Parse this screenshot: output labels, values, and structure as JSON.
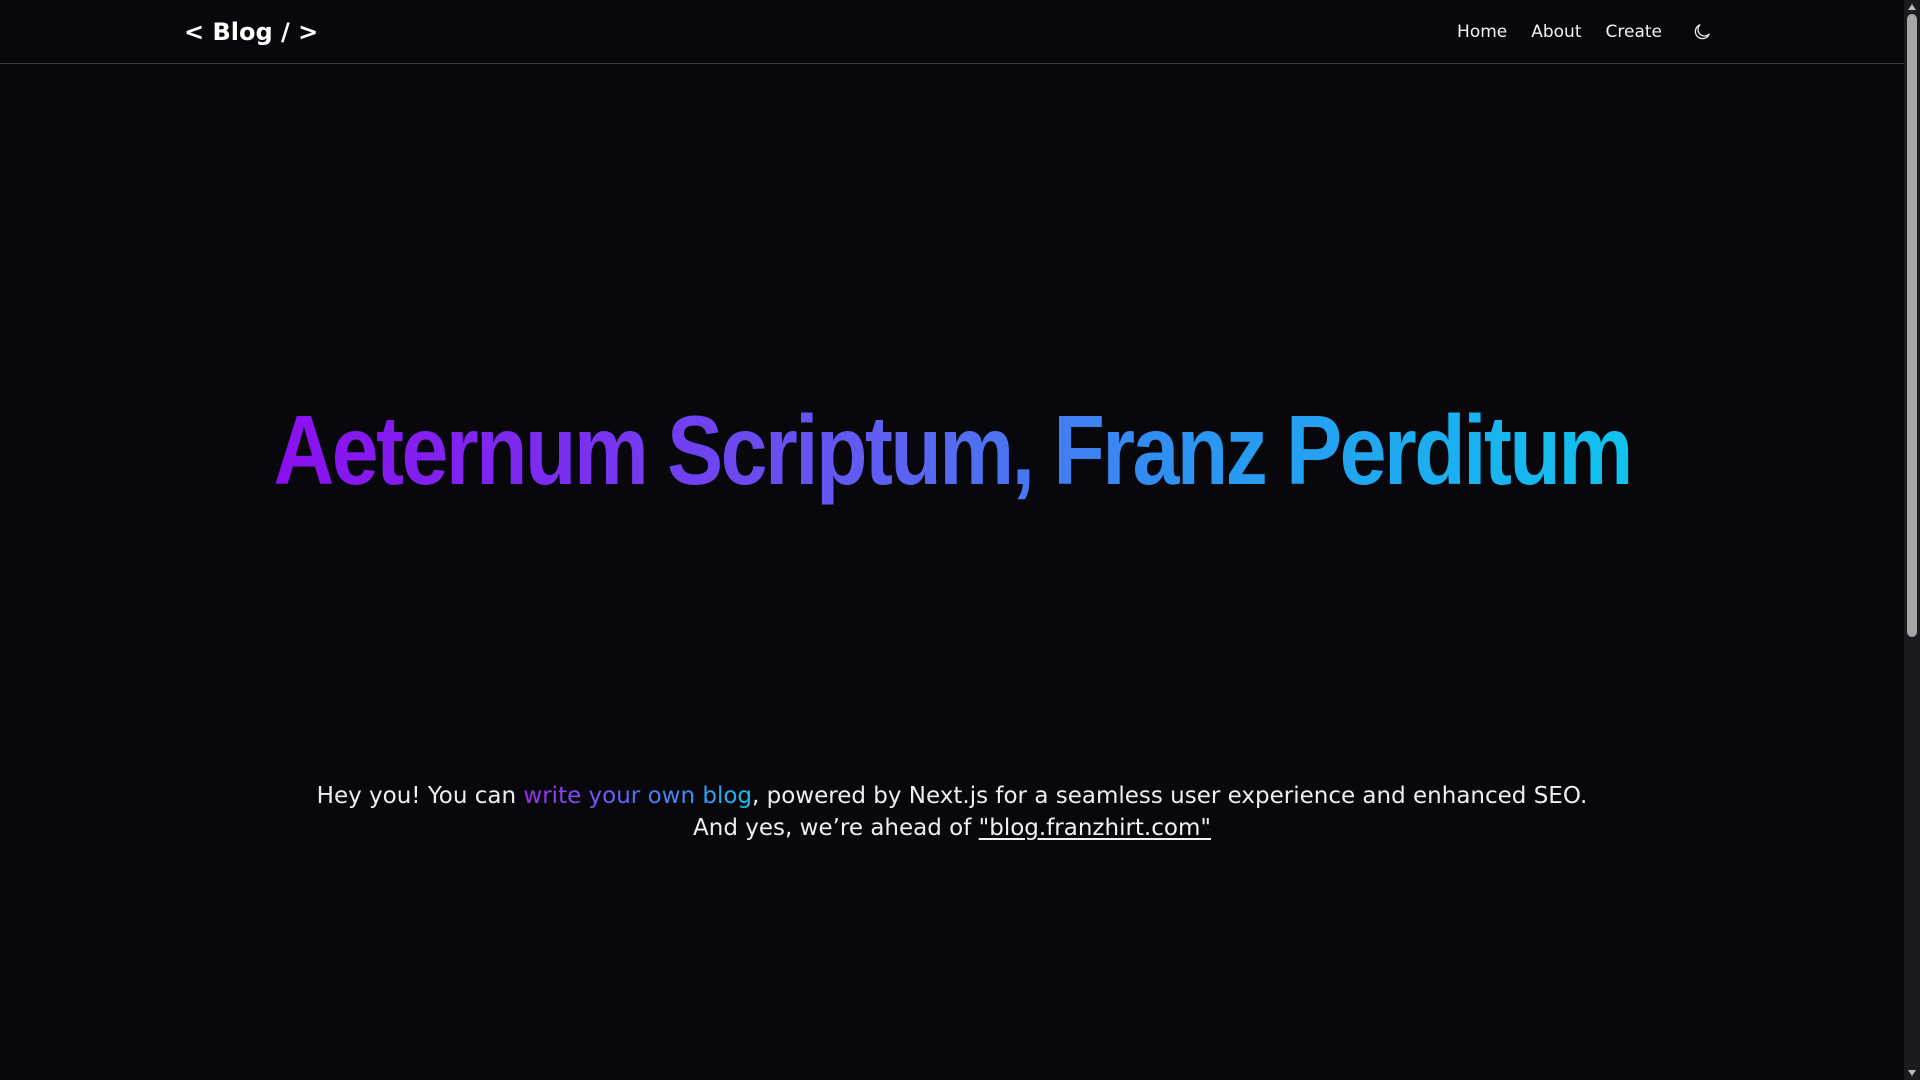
{
  "nav": {
    "logo": "< Blog / >",
    "links": [
      "Home",
      "About",
      "Create"
    ],
    "theme_icon": "moon-icon"
  },
  "hero": {
    "title": "Aeternum Scriptum, Franz Perditum",
    "gradient_colors": [
      "#8b0ff0",
      "#5f5ff2",
      "#10c3ee"
    ]
  },
  "intro": {
    "text_before": "Hey you! You can ",
    "link_text": "write your own blog",
    "text_after": ", powered by Next.js for a seamless user experience and enhanced SEO.",
    "line2_text": "And yes, we’re ahead of ",
    "line2_link": "\"blog.franzhirt.com\""
  },
  "colors": {
    "background": "#07070c",
    "text": "#eeeeee",
    "border": "#3a3a3f"
  }
}
